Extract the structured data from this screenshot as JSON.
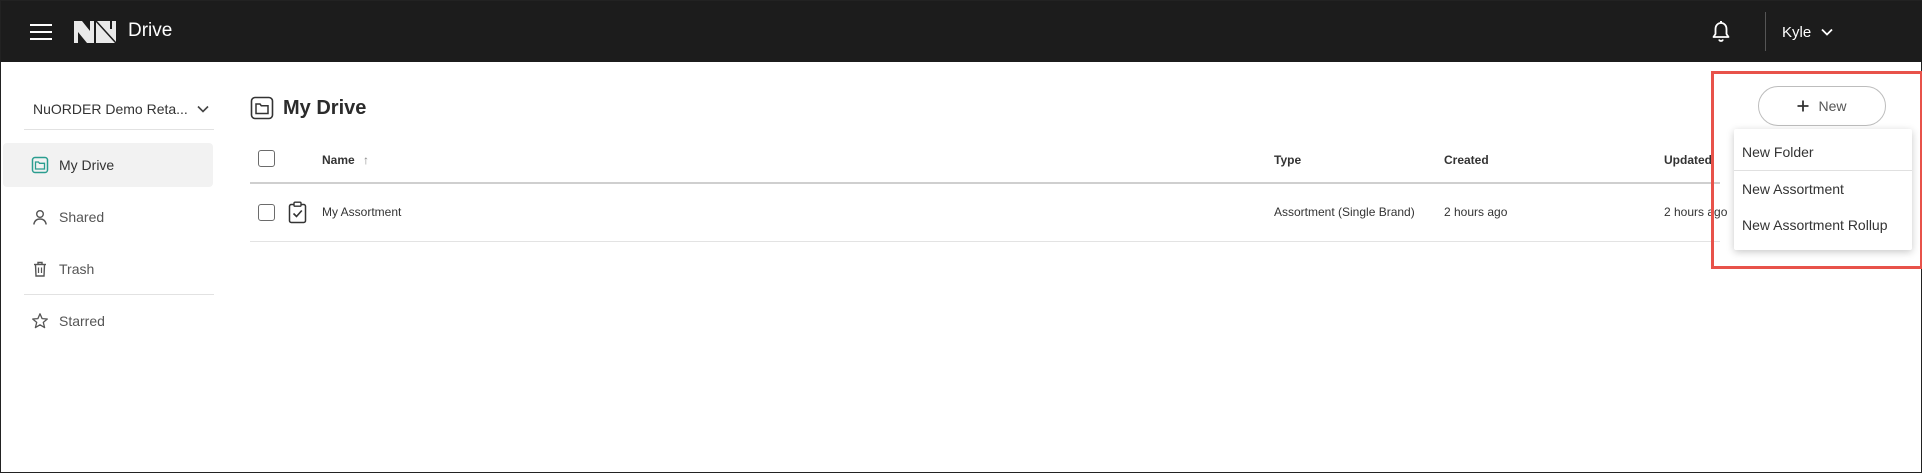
{
  "app": {
    "title": "Drive"
  },
  "user": {
    "name": "Kyle"
  },
  "sidebar": {
    "org_name": "NuORDER Demo Reta...",
    "items": [
      {
        "label": "My Drive",
        "icon": "folder-icon",
        "active": true
      },
      {
        "label": "Shared",
        "icon": "person-icon",
        "active": false
      },
      {
        "label": "Trash",
        "icon": "trash-icon",
        "active": false
      },
      {
        "label": "Starred",
        "icon": "star-icon",
        "active": false
      }
    ]
  },
  "main": {
    "title": "My Drive",
    "columns": {
      "name": "Name",
      "type": "Type",
      "created": "Created",
      "updated": "Updated"
    },
    "sort": {
      "column": "Name",
      "direction": "ascending"
    },
    "rows": [
      {
        "name": "My Assortment",
        "type": "Assortment (Single Brand)",
        "created": "2 hours ago",
        "updated": "2 hours ago",
        "icon": "clipboard-check-icon"
      }
    ]
  },
  "new_menu": {
    "button_label": "New",
    "items": [
      "New Folder",
      "New Assortment",
      "New Assortment Rollup"
    ]
  },
  "colors": {
    "topbar": "#1c1c1c",
    "accent": "#2a9d8f",
    "highlight": "#e8524a"
  }
}
